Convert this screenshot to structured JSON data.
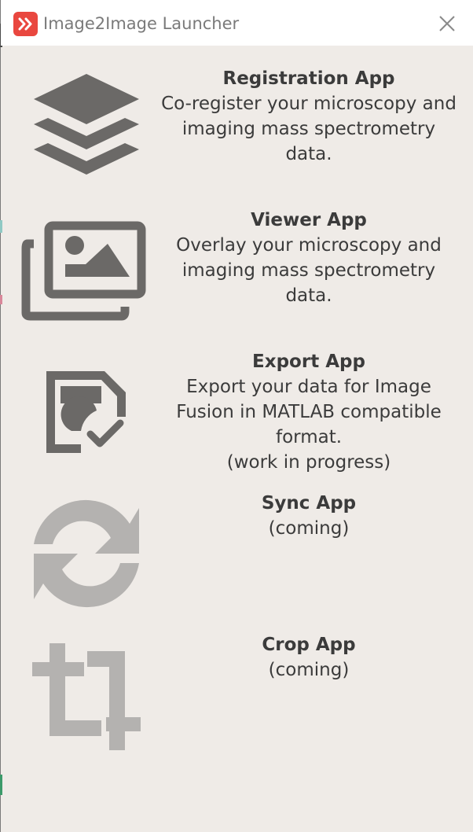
{
  "window": {
    "title": "Image2Image Launcher",
    "icon": "image2image-logo-icon",
    "close_icon": "close-icon"
  },
  "apps": [
    {
      "name": "Registration App",
      "description": "Co-register your microscopy and\nimaging mass spectrometry\ndata.",
      "icon": "layers-icon",
      "enabled": true
    },
    {
      "name": "Viewer App",
      "description": "Overlay your microscopy and\nimaging mass spectrometry\ndata.",
      "icon": "image-gallery-icon",
      "enabled": true
    },
    {
      "name": "Export App",
      "description": "Export your data for Image\nFusion in MATLAB compatible\nformat.\n(work in progress)",
      "icon": "save-check-icon",
      "enabled": true
    },
    {
      "name": "Sync App",
      "description": "(coming)",
      "icon": "sync-icon",
      "enabled": false
    },
    {
      "name": "Crop App",
      "description": "(coming)",
      "icon": "crop-icon",
      "enabled": false
    }
  ],
  "colors": {
    "accent": "#e9473f",
    "icon_enabled": "#6b6967",
    "icon_disabled": "#b4b2b0",
    "background": "#efebe7",
    "text": "#3b3b3b"
  }
}
